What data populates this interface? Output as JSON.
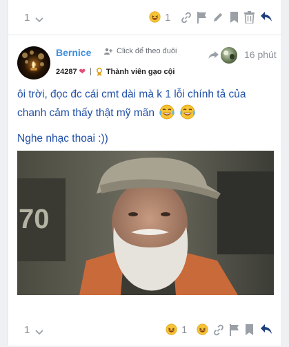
{
  "post_actions_top": {
    "reply_count": "1",
    "reaction_count": "1"
  },
  "post": {
    "username": "Bernice",
    "follow_label": "Click để theo đuôi",
    "likes_count": "24287",
    "rank_title": "Thành viên gạo cội",
    "time_ago": "16 phút",
    "body_line1": "ôi trời, đọc đc cái cmt dài mà k 1 lỗi chính tả của chanh cảm thấy thật mỹ mãn",
    "body_line2": "Nghe nhạc thoai :))",
    "gif_overlay_text": "70"
  },
  "post_actions_bottom": {
    "reply_count": "1",
    "reaction_count": "1"
  },
  "colors": {
    "link_blue": "#3d8de0",
    "body_text": "#1f4fa8",
    "icon_gray": "#9aa0a6",
    "reply_arrow": "#1d3f7c",
    "heart": "#e0527a"
  },
  "icons": [
    "chevron-down-icon",
    "laugh-emoji-icon",
    "link-icon",
    "flag-icon",
    "edit-icon",
    "bookmark-icon",
    "trash-icon",
    "reply-icon",
    "user-plus-icon",
    "heart-icon",
    "rank-badge-icon",
    "share-icon"
  ]
}
